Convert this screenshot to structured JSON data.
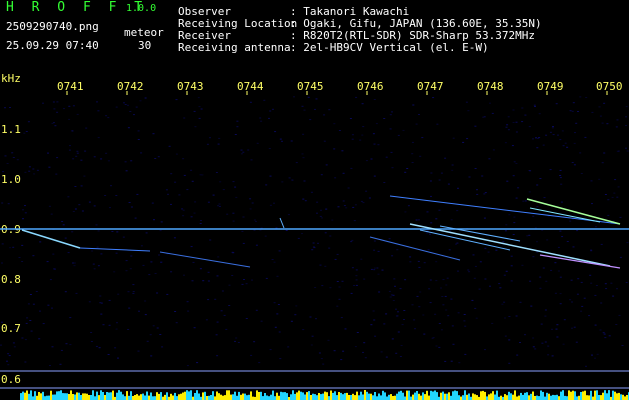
{
  "header": {
    "brand": "H R O F F T",
    "version": "1.0.0",
    "file": "2509290740.png",
    "meteor_label": "meteor",
    "datetime": "25.09.29 07:40",
    "meteor_count": "30"
  },
  "info": [
    {
      "key": "Observer",
      "value": ": Takanori Kawachi"
    },
    {
      "key": "Receiving Location",
      "value": ": Ogaki, Gifu, JAPAN (136.60E, 35.35N)"
    },
    {
      "key": "Receiver",
      "value": ": R820T2(RTL-SDR) SDR-Sharp 53.372MHz"
    },
    {
      "key": "Receiving antenna",
      "value": ": 2el-HB9CV Vertical (el. E-W)"
    }
  ],
  "axis": {
    "unit": "kHz",
    "time_labels": [
      "0741",
      "0742",
      "0743",
      "0744",
      "0745",
      "0746",
      "0747",
      "0748",
      "0749",
      "0750"
    ],
    "freq_labels": [
      "1.1",
      "1.0",
      "0.9",
      "0.8",
      "0.7",
      "0.6"
    ]
  },
  "colors": {
    "background": "#000000",
    "text_green": "#33ff33",
    "text_yellow": "#ffff66",
    "noise_floor": "#0a0a60",
    "carrier": "#4fa8ff",
    "meteor_trail": "#9fe0ff",
    "level_high": "#ffee00",
    "level_low": "#22d5ff"
  }
}
